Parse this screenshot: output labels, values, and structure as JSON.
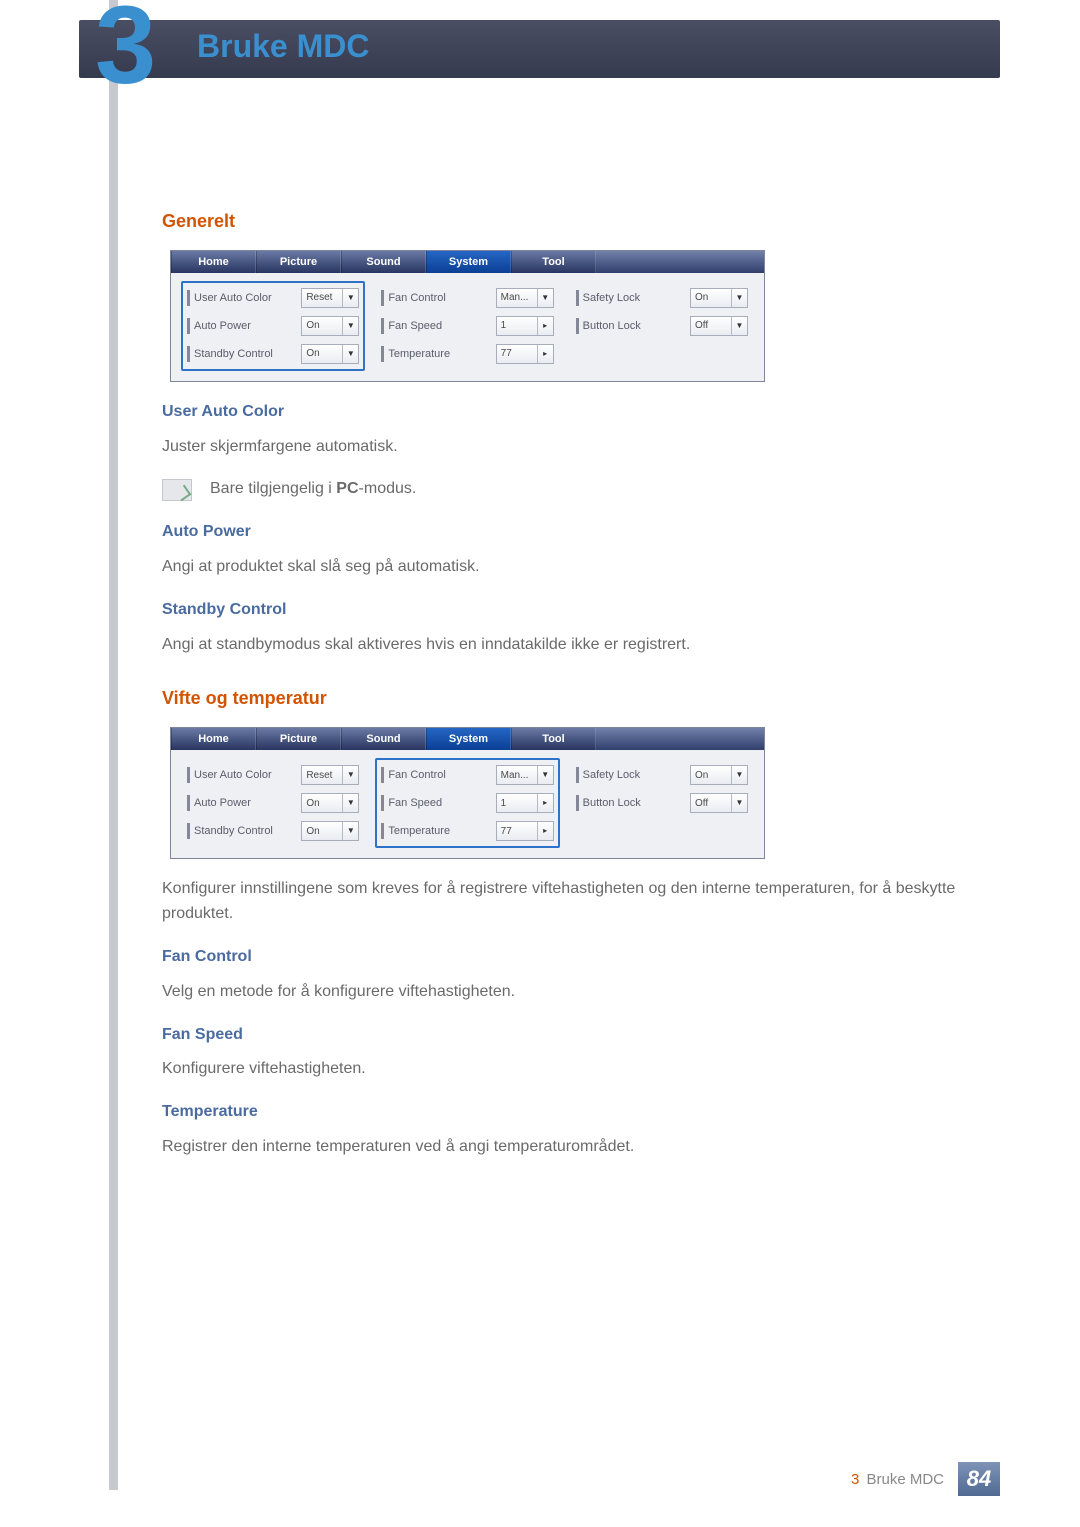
{
  "header": {
    "chapter_number": "3",
    "chapter_title": "Bruke MDC"
  },
  "sections": {
    "generelt": {
      "title": "Generelt",
      "user_auto_color": {
        "heading": "User Auto Color",
        "body": "Juster skjermfargene automatisk.",
        "note_pre": "Bare tilgjengelig i ",
        "note_bold": "PC",
        "note_post": "-modus."
      },
      "auto_power": {
        "heading": "Auto Power",
        "body": "Angi at produktet skal slå seg på automatisk."
      },
      "standby_control": {
        "heading": "Standby Control",
        "body": "Angi at standbymodus skal aktiveres hvis en inndatakilde ikke er registrert."
      }
    },
    "vifte": {
      "title": "Vifte og temperatur",
      "intro": "Konfigurer innstillingene som kreves for å registrere viftehastigheten og den interne temperaturen, for å beskytte produktet.",
      "fan_control": {
        "heading": "Fan Control",
        "body": "Velg en metode for å konfigurere viftehastigheten."
      },
      "fan_speed": {
        "heading": "Fan Speed",
        "body": "Konfigurere viftehastigheten."
      },
      "temperature": {
        "heading": "Temperature",
        "body": "Registrer den interne temperaturen ved å angi temperaturområdet."
      }
    }
  },
  "ui_panel": {
    "tabs": [
      "Home",
      "Picture",
      "Sound",
      "System",
      "Tool"
    ],
    "col1": [
      {
        "label": "User Auto Color",
        "value": "Reset",
        "caret": "▼"
      },
      {
        "label": "Auto Power",
        "value": "On",
        "caret": "▼"
      },
      {
        "label": "Standby Control",
        "value": "On",
        "caret": "▼"
      }
    ],
    "col2": [
      {
        "label": "Fan Control",
        "value": "Man...",
        "caret": "▼"
      },
      {
        "label": "Fan Speed",
        "value": "1",
        "caret": "▸"
      },
      {
        "label": "Temperature",
        "value": "77",
        "caret": "▸"
      }
    ],
    "col3": [
      {
        "label": "Safety Lock",
        "value": "On",
        "caret": "▼"
      },
      {
        "label": "Button Lock",
        "value": "Off",
        "caret": "▼"
      }
    ]
  },
  "footer": {
    "chapter_num": "3",
    "label": "Bruke MDC",
    "page": "84"
  }
}
